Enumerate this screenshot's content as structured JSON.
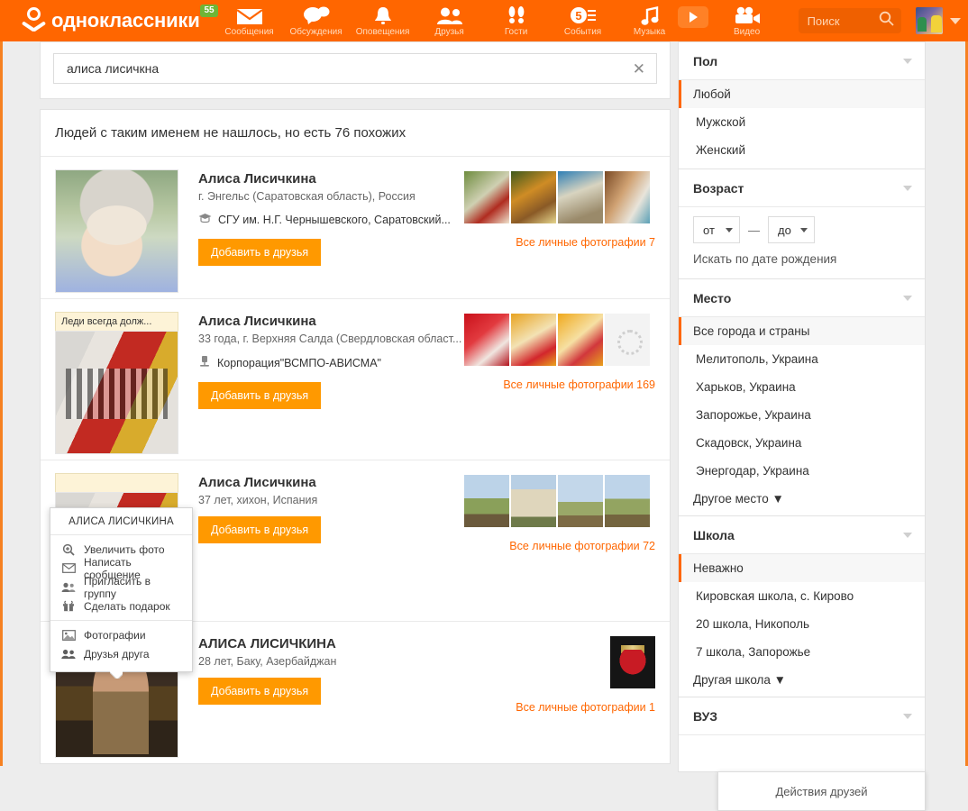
{
  "header": {
    "brand": "одноклассники",
    "message_badge": "55",
    "nav": [
      {
        "label": "Сообщения",
        "icon": "envelope-icon"
      },
      {
        "label": "Обсуждения",
        "icon": "chat-bubbles-icon"
      },
      {
        "label": "Оповещения",
        "icon": "bell-icon"
      },
      {
        "label": "Друзья",
        "icon": "people-icon"
      },
      {
        "label": "Гости",
        "icon": "footprints-icon"
      },
      {
        "label": "События",
        "icon": "calendar-five-icon"
      },
      {
        "label": "Музыка",
        "icon": "music-note-icon"
      },
      {
        "label": "Видео",
        "icon": "video-camera-icon"
      }
    ],
    "search_placeholder": "Поиск",
    "search_value": "",
    "search_icon": "search-icon",
    "profile_caret_icon": "chevron-down-icon"
  },
  "search": {
    "value": "алиса лисичкна",
    "placeholder": "",
    "clear_icon": "close-icon"
  },
  "results": {
    "heading": "Людей с таким именем не нашлось, но есть 76 похожих",
    "cards": [
      {
        "name": "Алиса Лисичкина",
        "meta": "г. Энгельс (Саратовская область), Россия",
        "edu": "СГУ им. Н.Г. Чернышевского, Саратовский...",
        "edu_icon": "graduation-cap-icon",
        "add_label": "Добавить в друзья",
        "photos_label": "Все личные фотографии 7",
        "caption": ""
      },
      {
        "name": "Алиса Лисичкина",
        "meta": "33 года, г. Верхняя Салда (Свердловская област...",
        "edu": "Корпорация\"ВСМПО-АВИСМА\"",
        "edu_icon": "workplace-icon",
        "add_label": "Добавить в друзья",
        "photos_label": "Все личные фотографии 169",
        "caption": "Леди всегда долж..."
      },
      {
        "name": "Алиса Лисичкина",
        "meta": "37 лет, хихон, Испания",
        "edu": "",
        "edu_icon": "",
        "add_label": "Добавить в друзья",
        "photos_label": "Все личные фотографии 72",
        "caption": ""
      },
      {
        "name": "АЛИСА ЛИСИЧКИНА",
        "meta": "28 лет, Баку, Азербайджан",
        "edu": "",
        "edu_icon": "",
        "add_label": "Добавить в друзья",
        "photos_label": "Все личные фотографии 1",
        "caption": ""
      }
    ]
  },
  "context_menu": {
    "title": "АЛИСА ЛИСИЧКИНА",
    "groups": [
      [
        {
          "label": "Увеличить фото",
          "icon": "zoom-in-icon"
        },
        {
          "label": "Написать сообщение",
          "icon": "envelope-icon"
        },
        {
          "label": "Пригласить в группу",
          "icon": "group-add-icon"
        },
        {
          "label": "Сделать подарок",
          "icon": "gift-icon"
        }
      ],
      [
        {
          "label": "Фотографии",
          "icon": "photo-icon"
        },
        {
          "label": "Друзья друга",
          "icon": "friends-icon"
        }
      ]
    ]
  },
  "sidebar": {
    "blocks": [
      {
        "title": "Пол",
        "options": [
          {
            "label": "Любой",
            "selected": true
          },
          {
            "label": "Мужской",
            "selected": false
          },
          {
            "label": "Женский",
            "selected": false
          }
        ]
      },
      {
        "title": "Возраст",
        "age_from": "от",
        "age_to": "до",
        "age_dash": "—",
        "birthdate_link": "Искать по дате рождения"
      },
      {
        "title": "Место",
        "options": [
          {
            "label": "Все города и страны",
            "selected": true
          },
          {
            "label": "Мелитополь, Украина",
            "selected": false
          },
          {
            "label": "Харьков, Украина",
            "selected": false
          },
          {
            "label": "Запорожье, Украина",
            "selected": false
          },
          {
            "label": "Скадовск, Украина",
            "selected": false
          },
          {
            "label": "Энергодар, Украина",
            "selected": false
          }
        ],
        "more": "Другое место ▼"
      },
      {
        "title": "Школа",
        "options": [
          {
            "label": "Неважно",
            "selected": true
          },
          {
            "label": "Кировская школа, с. Кирово",
            "selected": false
          },
          {
            "label": "20 школа, Никополь",
            "selected": false
          },
          {
            "label": "7 школа, Запорожье",
            "selected": false
          }
        ],
        "more": "Другая школа ▼"
      },
      {
        "title": "ВУЗ",
        "options": [],
        "more": ""
      }
    ]
  },
  "tooltip": {
    "friends_actions": "Действия друзей"
  },
  "colors": {
    "brand_orange": "#f60",
    "header_orange": "#f60",
    "border_orange": "#f68121",
    "link_orange": "#f60",
    "badge_green": "#6fb536",
    "page_bg": "#ededed"
  }
}
